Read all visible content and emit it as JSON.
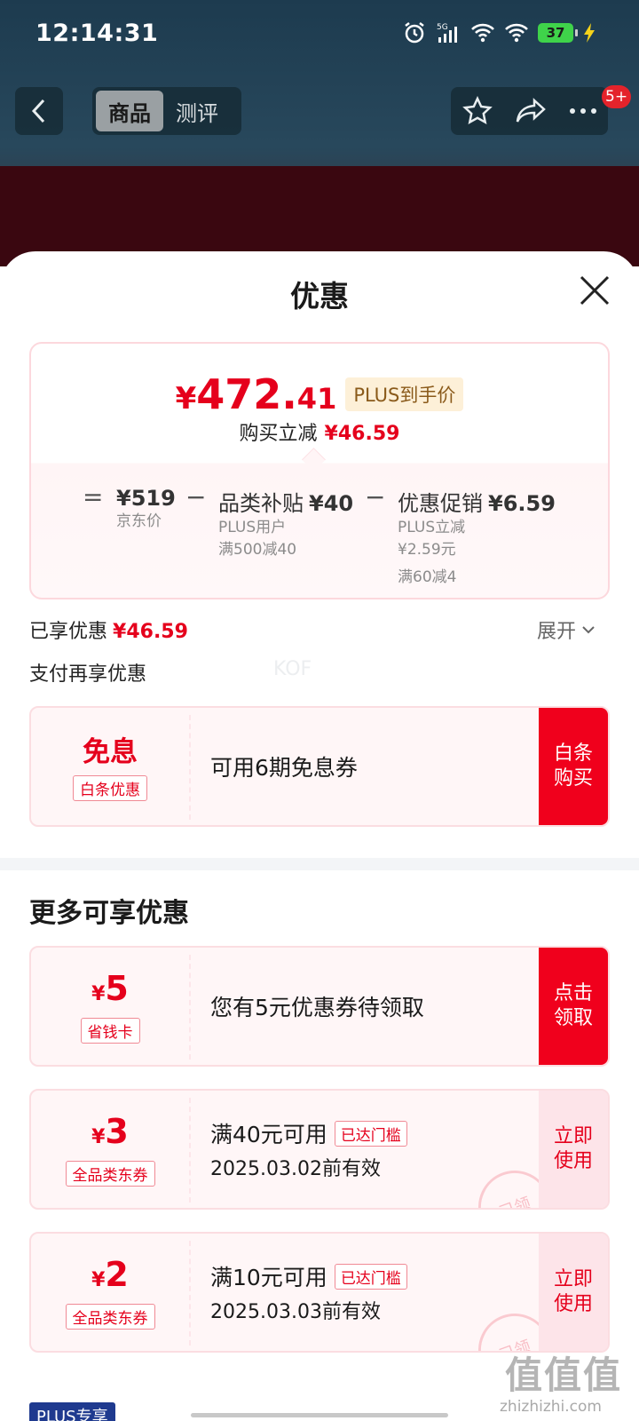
{
  "status_bar": {
    "time": "12:14:31",
    "battery": "37"
  },
  "nav": {
    "tabs": [
      "商品",
      "测评"
    ],
    "badge": "5+"
  },
  "sheet": {
    "title": "优惠",
    "price_card": {
      "price_yen": "¥",
      "price_int": "472.",
      "price_dec": "41",
      "plus_tag": "PLUS到手价",
      "sub_label": "购买立减",
      "sub_value": "¥46.59",
      "breakdown": {
        "eq": "=",
        "jd_price": "¥519",
        "jd_label": "京东价",
        "minus": "−",
        "cat_label": "品类补贴",
        "cat_value": "¥40",
        "cat_sub1": "PLUS用户",
        "cat_sub2": "满500减40",
        "promo_label": "优惠促销",
        "promo_value": "¥6.59",
        "promo_sub1": "PLUS立减",
        "promo_sub2": "¥2.59元",
        "promo_sub3": "满60减4"
      }
    },
    "enjoyed_label": "已享优惠",
    "enjoyed_value": "¥46.59",
    "expand_label": "展开",
    "pay_more_label": "支付再享优惠",
    "watermark": "KOF",
    "baitiao": {
      "value": "免息",
      "tag": "白条优惠",
      "text": "可用6期免息券",
      "button_line1": "白条",
      "button_line2": "购买"
    },
    "more_title": "更多可享优惠",
    "coupons": [
      {
        "yen": "¥",
        "value": "5",
        "tag": "省钱卡",
        "line1": "您有5元优惠券待领取",
        "line2": "",
        "reach": "",
        "btn1": "点击",
        "btn2": "领取"
      },
      {
        "yen": "¥",
        "value": "3",
        "tag": "全品类东券",
        "line1": "满40元可用",
        "reach": "已达门槛",
        "line2": "2025.03.02前有效",
        "btn1": "立即",
        "btn2": "使用",
        "stamp": "已领"
      },
      {
        "yen": "¥",
        "value": "2",
        "tag": "全品类东券",
        "line1": "满10元可用",
        "reach": "已达门槛",
        "line2": "2025.03.03前有效",
        "btn1": "立即",
        "btn2": "使用",
        "stamp": "已领"
      }
    ],
    "plus_only": "PLUS专享"
  },
  "watermark_site": {
    "mark": "值值值",
    "url": "zhizhizhi.com"
  },
  "colors": {
    "accent_red": "#e5001c",
    "plus_gold": "#8a5a1a",
    "plus_blue": "#1f3a8f"
  }
}
